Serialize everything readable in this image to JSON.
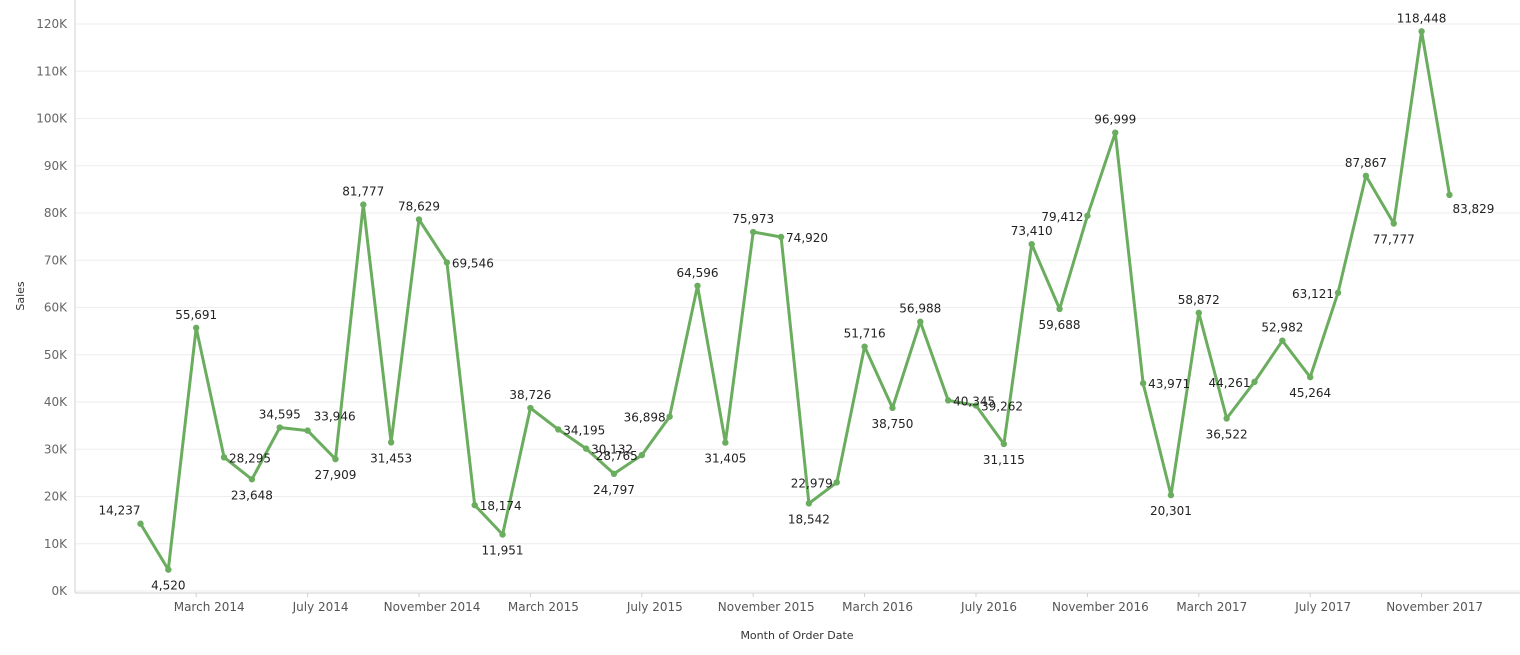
{
  "chart_data": {
    "type": "line",
    "xlabel": "Month of Order Date",
    "ylabel": "Sales",
    "ylim": [
      0,
      120000
    ],
    "yticks": [
      {
        "value": 0,
        "label": "0K"
      },
      {
        "value": 10000,
        "label": "10K"
      },
      {
        "value": 20000,
        "label": "20K"
      },
      {
        "value": 30000,
        "label": "30K"
      },
      {
        "value": 40000,
        "label": "40K"
      },
      {
        "value": 50000,
        "label": "50K"
      },
      {
        "value": 60000,
        "label": "60K"
      },
      {
        "value": 70000,
        "label": "70K"
      },
      {
        "value": 80000,
        "label": "80K"
      },
      {
        "value": 90000,
        "label": "90K"
      },
      {
        "value": 100000,
        "label": "100K"
      },
      {
        "value": 110000,
        "label": "110K"
      },
      {
        "value": 120000,
        "label": "120K"
      }
    ],
    "xticks": [
      {
        "x": "2014-03",
        "label": "March 2014"
      },
      {
        "x": "2014-07",
        "label": "July 2014"
      },
      {
        "x": "2014-11",
        "label": "November 2014"
      },
      {
        "x": "2015-03",
        "label": "March 2015"
      },
      {
        "x": "2015-07",
        "label": "July 2015"
      },
      {
        "x": "2015-11",
        "label": "November 2015"
      },
      {
        "x": "2016-03",
        "label": "March 2016"
      },
      {
        "x": "2016-07",
        "label": "July 2016"
      },
      {
        "x": "2016-11",
        "label": "November 2016"
      },
      {
        "x": "2017-03",
        "label": "March 2017"
      },
      {
        "x": "2017-07",
        "label": "July 2017"
      },
      {
        "x": "2017-11",
        "label": "November 2017"
      }
    ],
    "color": "#6aad5e",
    "grid": true,
    "x": [
      "2014-01",
      "2014-02",
      "2014-03",
      "2014-04",
      "2014-05",
      "2014-06",
      "2014-07",
      "2014-08",
      "2014-09",
      "2014-10",
      "2014-11",
      "2014-12",
      "2015-01",
      "2015-02",
      "2015-03",
      "2015-04",
      "2015-05",
      "2015-06",
      "2015-07",
      "2015-08",
      "2015-09",
      "2015-10",
      "2015-11",
      "2015-12",
      "2016-01",
      "2016-02",
      "2016-03",
      "2016-04",
      "2016-05",
      "2016-06",
      "2016-07",
      "2016-08",
      "2016-09",
      "2016-10",
      "2016-11",
      "2016-12",
      "2017-01",
      "2017-02",
      "2017-03",
      "2017-04",
      "2017-05",
      "2017-06",
      "2017-07",
      "2017-08",
      "2017-09",
      "2017-10",
      "2017-11",
      "2017-12"
    ],
    "values": [
      14237,
      4520,
      55691,
      28295,
      23648,
      34595,
      33946,
      27909,
      81777,
      31453,
      78629,
      69546,
      18174,
      11951,
      38726,
      34195,
      30132,
      24797,
      28765,
      36898,
      64596,
      31405,
      75973,
      74920,
      18542,
      22979,
      51716,
      38750,
      56988,
      40345,
      39262,
      31115,
      73410,
      59688,
      79412,
      96999,
      43971,
      20301,
      58872,
      36522,
      44261,
      52982,
      45264,
      63121,
      87867,
      77777,
      118448,
      83829
    ],
    "data_labels": [
      "14,237",
      "4,520",
      "55,691",
      "28,295",
      "23,648",
      "34,595",
      "",
      "27,909",
      "81,777",
      "31,453",
      "78,629",
      "69,546",
      "18,174",
      "11,951",
      "38,726",
      "34,195",
      "30,132",
      "24,797",
      "28,765",
      "36,898",
      "64,596",
      "31,405",
      "75,973",
      "74,920",
      "18,542",
      "22,979",
      "51,716",
      "38,750",
      "56,988",
      "40,345",
      "39,262",
      "31,115",
      "73,410",
      "59,688",
      "79,412",
      "96,999",
      "43,971",
      "20,301",
      "58,872",
      "36,522",
      "44,261",
      "52,982",
      "45,264",
      "63,121",
      "87,867",
      "77,777",
      "118,448",
      "83,829"
    ],
    "extra_labels": [
      {
        "label": "33,946",
        "near": "2014-07"
      }
    ]
  }
}
